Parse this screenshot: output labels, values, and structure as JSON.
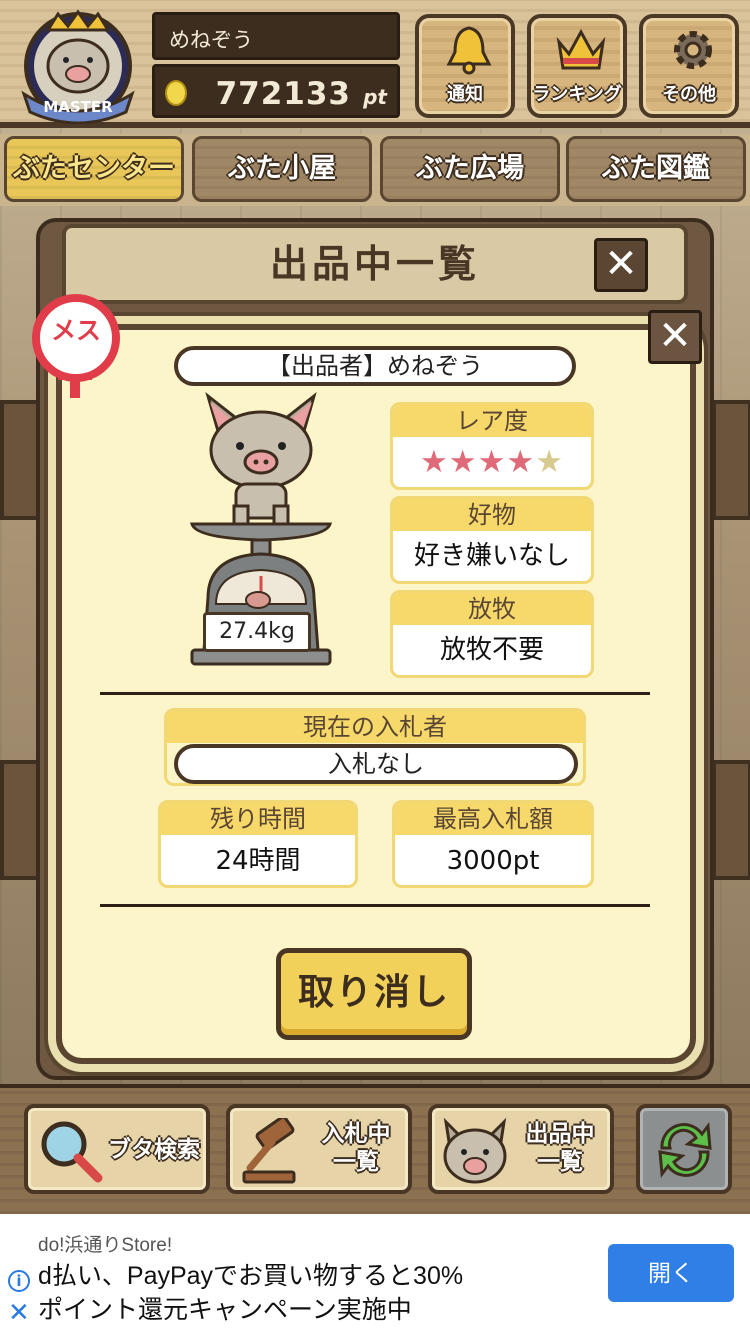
{
  "header": {
    "badge_text": "MASTER",
    "username": "めねぞう",
    "points": "772133",
    "points_unit": "pt",
    "buttons": [
      {
        "label": "通知",
        "icon": "bell-icon"
      },
      {
        "label": "ランキング",
        "icon": "crown-icon"
      },
      {
        "label": "その他",
        "icon": "gear-icon"
      }
    ]
  },
  "nav": {
    "tabs": [
      {
        "label": "ぶたセンター",
        "active": true
      },
      {
        "label": "ぶた小屋",
        "active": false
      },
      {
        "label": "ぶた広場",
        "active": false
      },
      {
        "label": "ぶた図鑑",
        "active": false
      }
    ]
  },
  "panel": {
    "title": "出品中一覧",
    "close_glyph": "✕",
    "gender_label": "メス",
    "seller": "【出品者】めねぞう",
    "weight": "27.4kg",
    "rarity": {
      "label": "レア度",
      "stars_filled": 4,
      "stars_total": 5,
      "star_glyph": "★"
    },
    "favorite": {
      "label": "好物",
      "value": "好き嫌いなし"
    },
    "grazing": {
      "label": "放牧",
      "value": "放牧不要"
    },
    "current_bidder": {
      "label": "現在の入札者",
      "value": "入札なし"
    },
    "time_left": {
      "label": "残り時間",
      "value": "24時間"
    },
    "highest_bid": {
      "label": "最高入札額",
      "value": "3000pt"
    },
    "cancel_label": "取り消し"
  },
  "toolbar": {
    "search_label": "ブタ検索",
    "bidding_label_1": "入札中",
    "bidding_label_2": "一覧",
    "listing_label_1": "出品中",
    "listing_label_2": "一覧"
  },
  "ad": {
    "store": "do!浜通りStore!",
    "line1": "d払い、PayPayでお買い物すると30%",
    "line2": "ポイント還元キャンペーン実施中",
    "button": "開く",
    "info_glyph": "i",
    "close_glyph": "✕"
  },
  "colors": {
    "wood_dark": "#4a3624",
    "card_bg": "#fbf5c9",
    "accent_yellow": "#f6d96a",
    "female_red": "#e03c4a",
    "star_pink": "#e06a78",
    "ad_blue": "#2f7fe6"
  }
}
